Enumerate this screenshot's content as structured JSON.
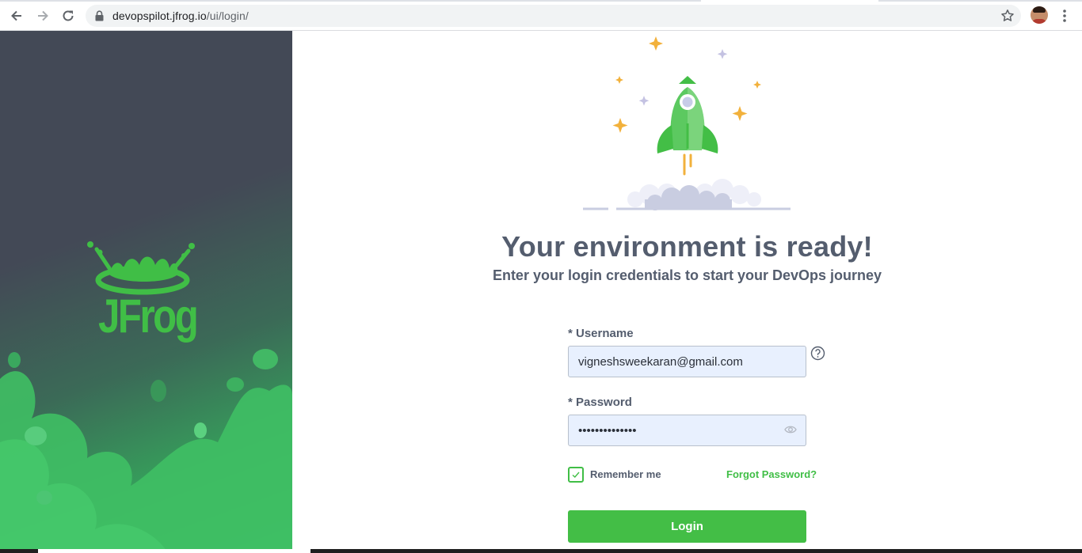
{
  "browser": {
    "url_host": "devopspilot.jfrog.io",
    "url_path": "/ui/login/",
    "icons": [
      "back-arrow-icon",
      "forward-arrow-icon",
      "reload-icon",
      "lock-icon",
      "star-icon",
      "profile-avatar",
      "kebab-menu-icon"
    ]
  },
  "brand": {
    "logo_text": "JFrog",
    "color": "#40be46"
  },
  "hero": {
    "title": "Your environment is ready!",
    "subtitle": "Enter your login credentials to start your DevOps journey"
  },
  "form": {
    "username_label": "* Username",
    "username_value": "vigneshsweekaran@gmail.com",
    "password_label": "* Password",
    "password_value": "••••••••••••••",
    "remember_label": "Remember me",
    "remember_checked": true,
    "forgot_label": "Forgot Password?",
    "login_label": "Login"
  },
  "colors": {
    "accent": "#43be46",
    "text": "#545d6e",
    "panel_dark": "#434956",
    "input_bg": "#e8f0fe"
  }
}
